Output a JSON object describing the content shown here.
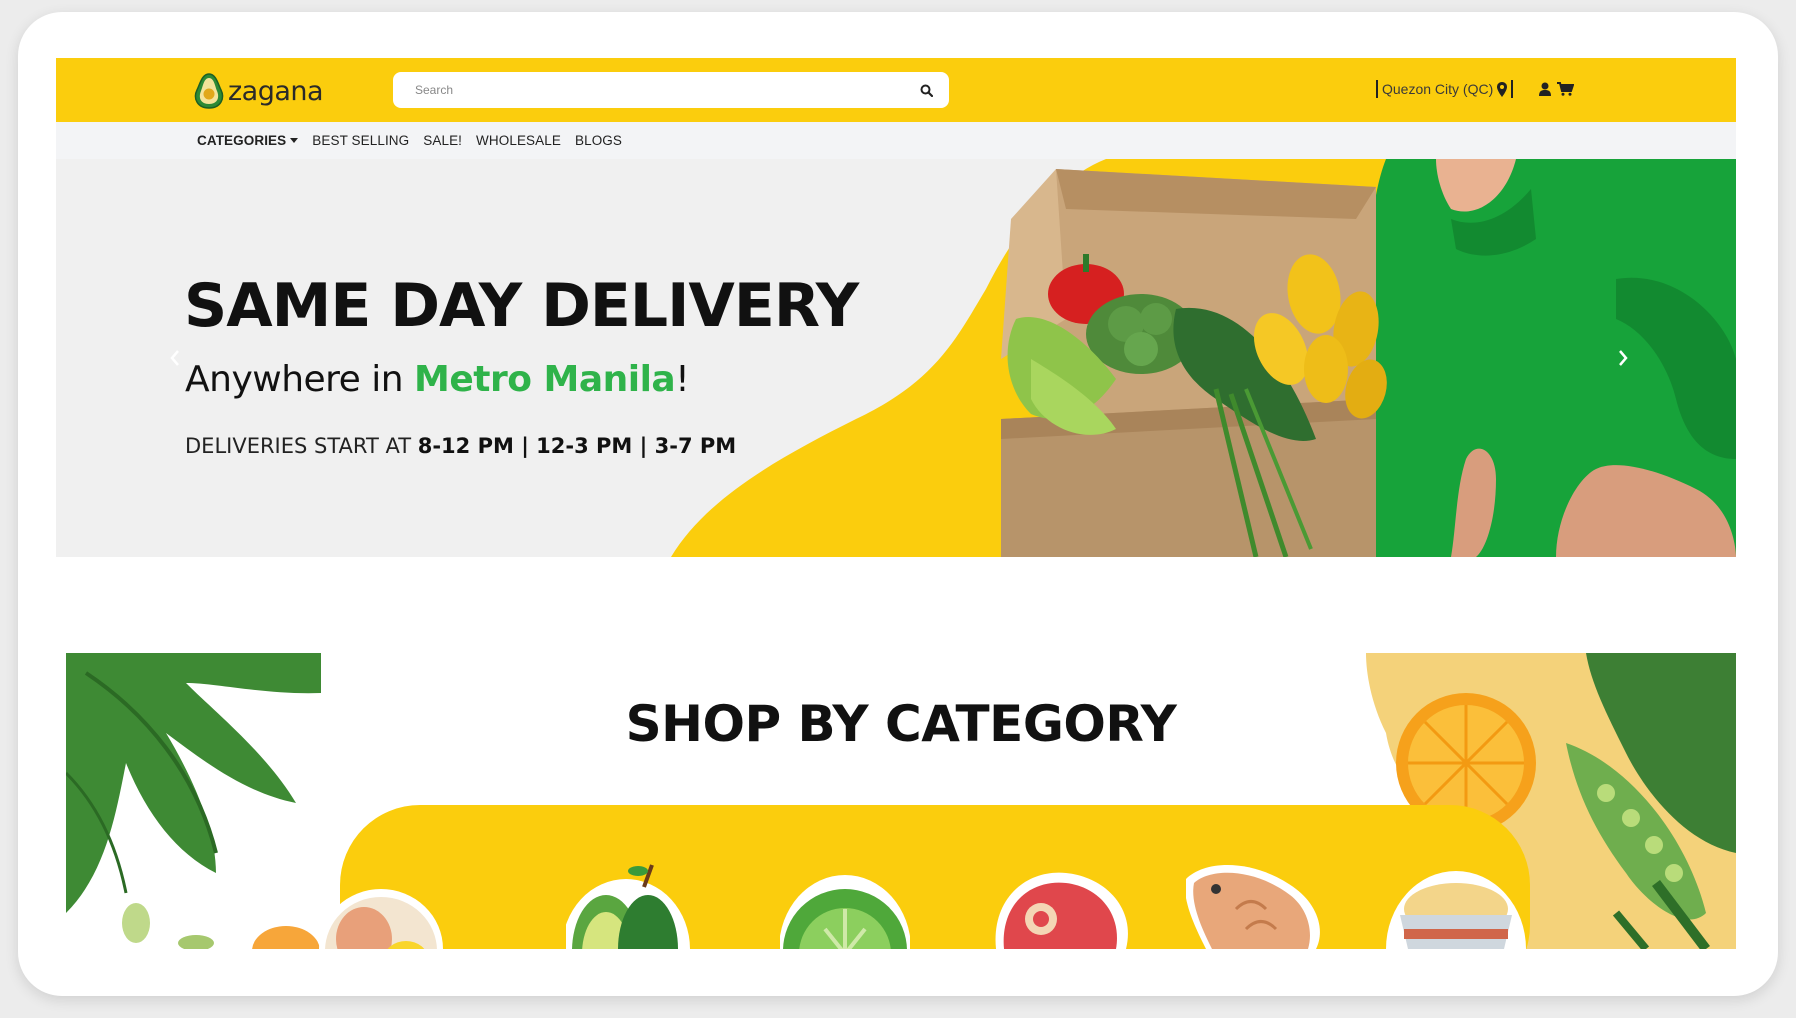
{
  "header": {
    "brand": "zagana",
    "search": {
      "placeholder": "Search",
      "value": ""
    },
    "location": "Quezon City (QC)",
    "icons": [
      "map-pin-icon",
      "user-icon",
      "cart-icon"
    ]
  },
  "nav": {
    "items": [
      {
        "label": "CATEGORIES",
        "has_dropdown": true
      },
      {
        "label": "BEST SELLING"
      },
      {
        "label": "SALE!"
      },
      {
        "label": "WHOLESALE"
      },
      {
        "label": "BLOGS"
      }
    ]
  },
  "hero": {
    "title": "SAME DAY DELIVERY",
    "subtitle_prefix": "Anywhere in ",
    "subtitle_accent": "Metro Manila",
    "subtitle_suffix": "!",
    "times_prefix": "DELIVERIES START AT ",
    "times_value": "8-12 PM | 12-3 PM | 3-7 PM"
  },
  "category_section": {
    "title": "SHOP BY CATEGORY",
    "icons": [
      "egg-icon",
      "avocado-icon",
      "cabbage-icon",
      "meat-icon",
      "fish-icon",
      "rice-icon"
    ]
  },
  "colors": {
    "brand_yellow": "#fbcd0d",
    "accent_green": "#2fb34a",
    "nav_bg": "#f3f4f6"
  }
}
